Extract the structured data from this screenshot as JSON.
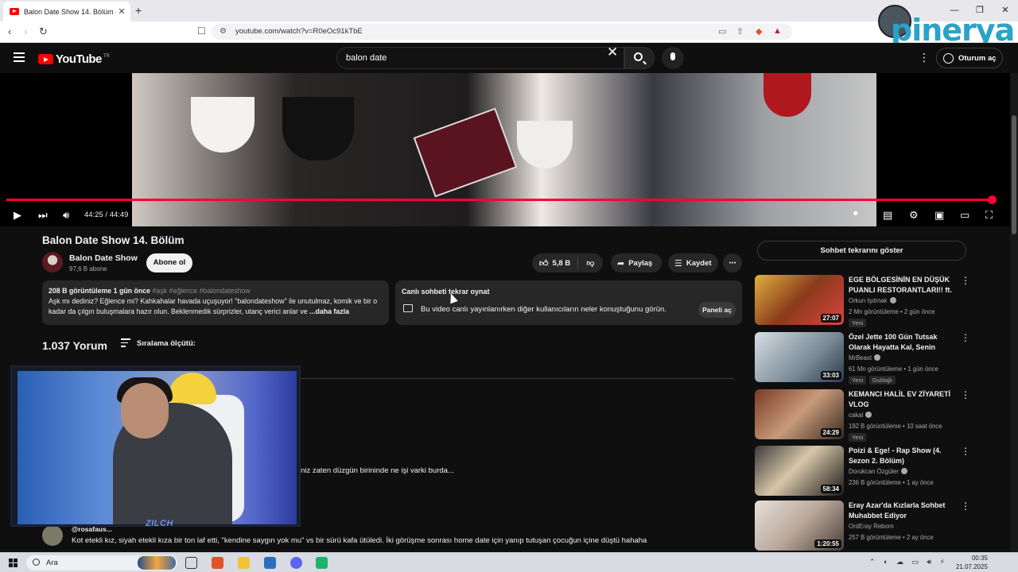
{
  "browser": {
    "tab_title": "Balon Date Show 14. Bölüm - YouTube",
    "url": "youtube.com/watch?v=R0eOc91kTbE"
  },
  "watermark": {
    "text": "pinerya"
  },
  "header": {
    "logo_text": "YouTube",
    "region": "TR",
    "search_value": "balon date",
    "signin_label": "Oturum aç"
  },
  "player": {
    "time": "44:25 / 44:49",
    "progress_fraction": 0.991
  },
  "video": {
    "title": "Balon Date Show 14. Bölüm",
    "channel": "Balon Date Show",
    "subscribers": "97,6 B abone",
    "subscribe_label": "Abone ol",
    "likes": "5,8 B",
    "share_label": "Paylaş",
    "save_label": "Kaydet"
  },
  "description": {
    "meta": "208 B görüntüleme  1 gün önce",
    "tags": "#aşk #eğlence #balondateshow",
    "text": "Aşk mı dediniz? Eğlence mi? Kahkahalar havada uçuşuyor! \"balondateshow\" ile unutulmaz, komik ve bir o kadar da çılgın buluşmalara hazır olun. Beklenmedik sürprizler, utanç verici anlar ve",
    "more": "...daha fazla"
  },
  "chat_replay": {
    "heading": "Canlı sohbeti tekrar oynat",
    "body": "Bu video canlı yayınlanırken diğer kullanıcıların neler konuştuğunu görün.",
    "button": "Paneli aç"
  },
  "comments": {
    "count": "1.037 Yorum",
    "sort_label": "Sıralama ölçütü:",
    "partial_comment": "iniz zaten düzgün birininde ne işi varki burda...",
    "comment2_user": "@rosafaus...",
    "comment2_text": "Kot etekli kız, siyah etekli kıza bir ton laf etti, \"kendine saygın yok mu\" vs bir sürü kafa ütüledi. İki görüşme sonrası home date için yanıp tutuşan çocuğun içine düştü hahaha"
  },
  "webcam": {
    "label": "ZILCH"
  },
  "sidebar": {
    "chat_button": "Sohbet tekrarını göster",
    "items": [
      {
        "title": "EGE BÖLGESİNİN EN DÜŞÜK PUANLI RESTORANTLARI!! ft. ...",
        "channel": "Orkun Işıtmak",
        "views": "2 Mn görüntüleme • 2 gün önce",
        "badges": [
          "Yeni"
        ],
        "duration": "27:07"
      },
      {
        "title": "Özel Jette 100 Gün Tutsak Olarak Hayatta Kal, Senin Olsun",
        "channel": "MrBeast",
        "views": "61 Mn görüntüleme • 1 gün önce",
        "badges": [
          "Yeni",
          "Dublajlı"
        ],
        "duration": "33:03"
      },
      {
        "title": "KEMANCI HALİL EV ZİYARETİ VLOG",
        "channel": "cakal",
        "views": "192 B görüntüleme • 10 saat önce",
        "badges": [
          "Yeni"
        ],
        "duration": "24:29"
      },
      {
        "title": "Poizi & Ege! - Rap Show (4. Sezon 2. Bölüm)",
        "channel": "Dorukcan Özgüler",
        "views": "236 B görüntüleme • 1 ay önce",
        "badges": [],
        "duration": "58:34"
      },
      {
        "title": "Eray Azar'da Kızlarla Sohbet Muhabbet Ediyor",
        "channel": "OrdEray Reborn",
        "views": "257 B görüntüleme • 2 ay önce",
        "badges": [],
        "duration": "1:20:55"
      }
    ]
  },
  "taskbar": {
    "search_placeholder": "Ara",
    "time": "00:35",
    "date": "21.07.2025"
  }
}
